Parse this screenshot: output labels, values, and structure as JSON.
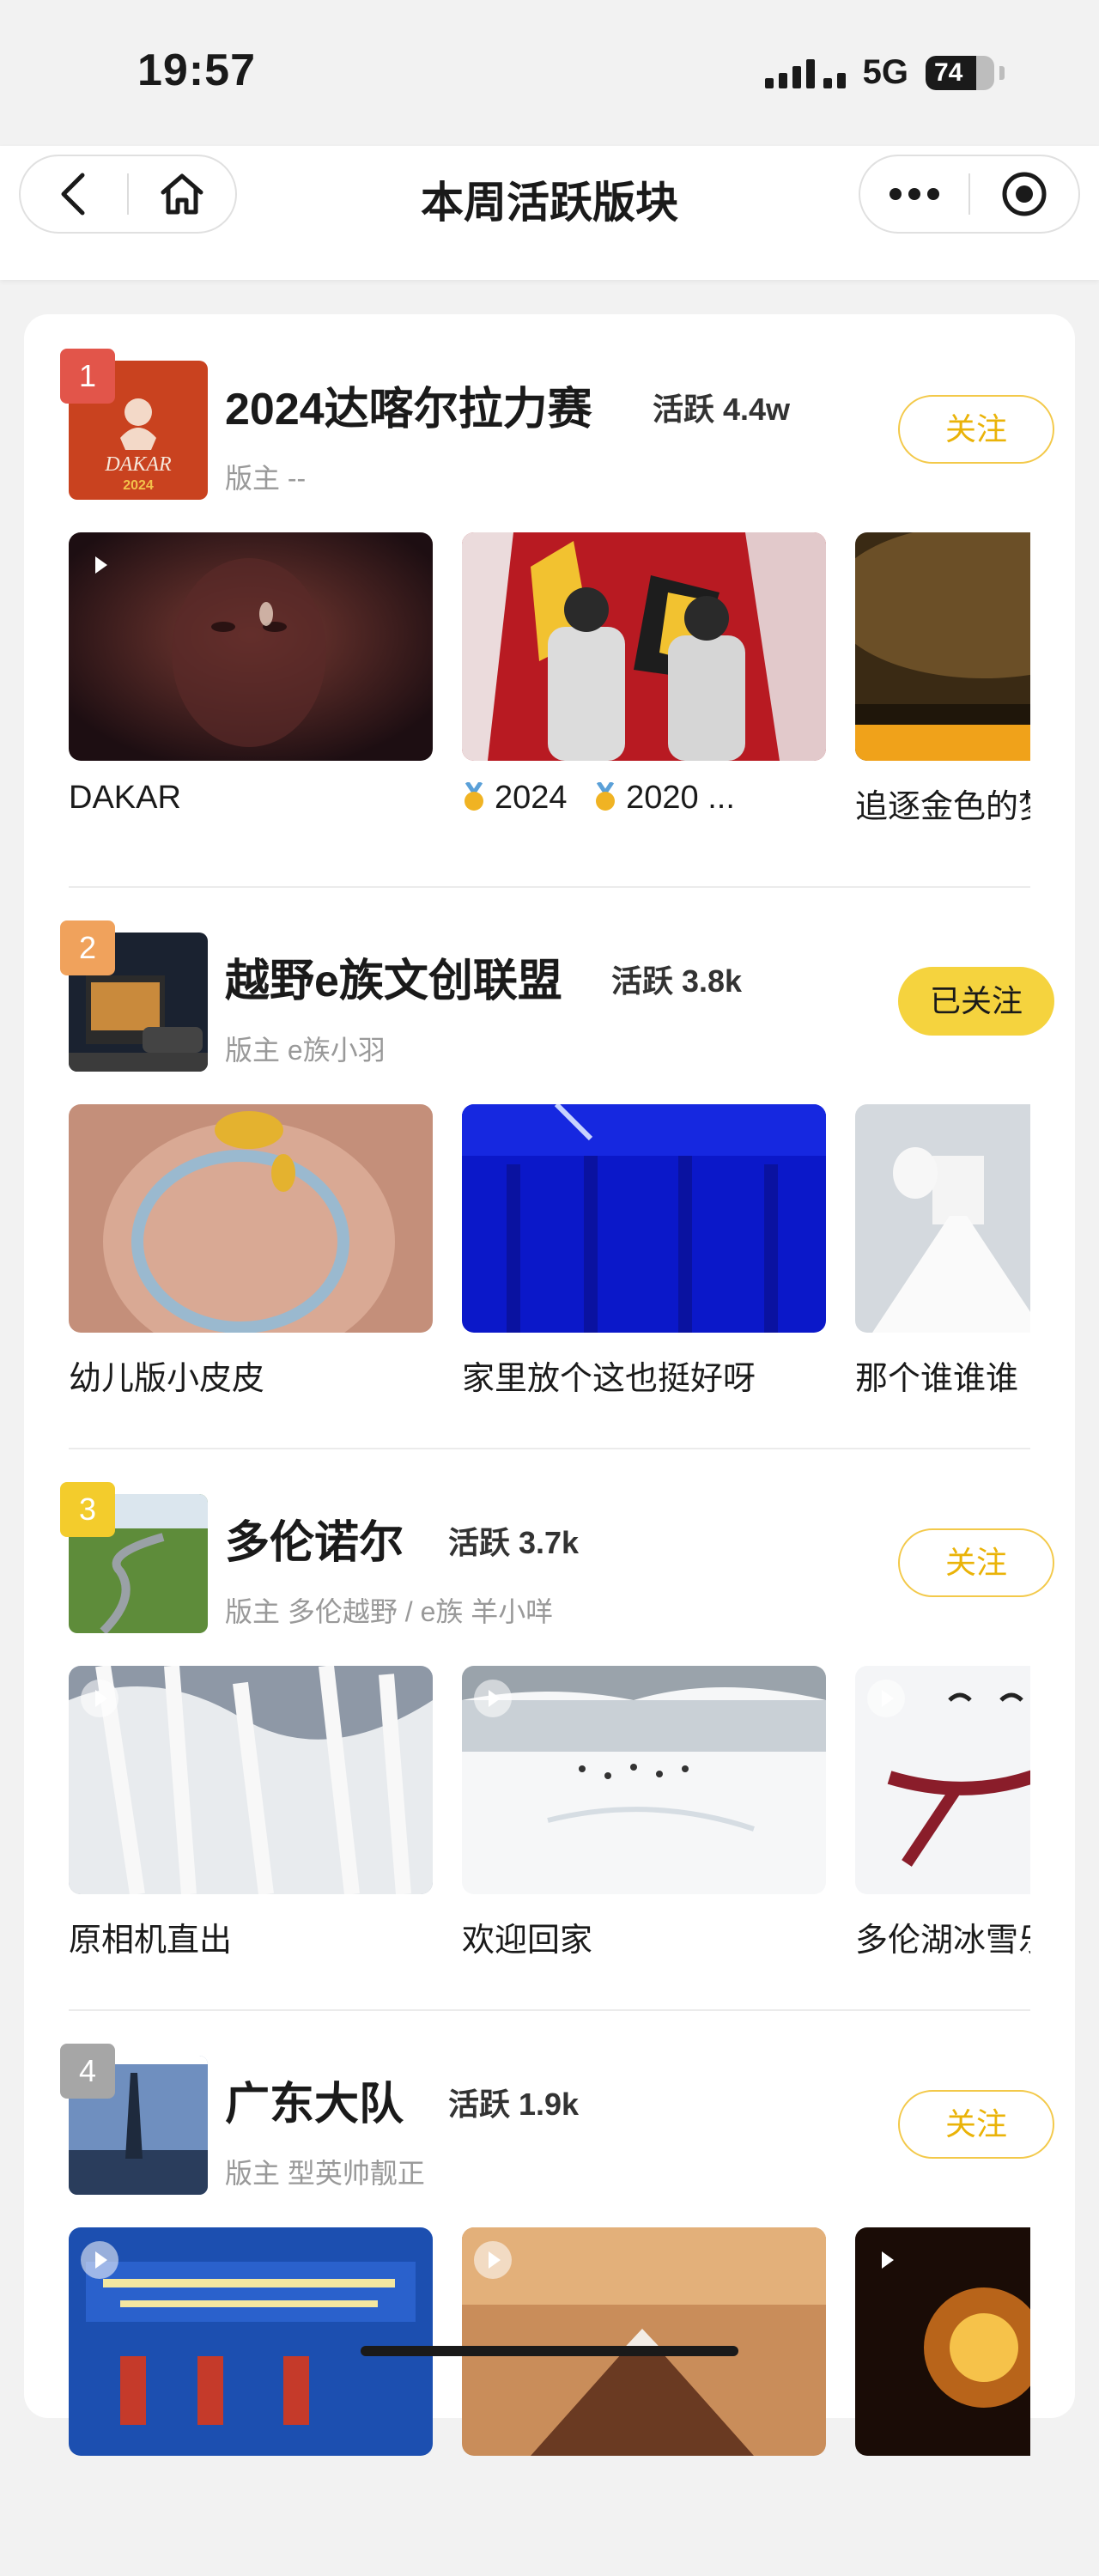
{
  "status_bar": {
    "time": "19:57",
    "network": "5G",
    "battery": "74",
    "battery_level_percent": 74
  },
  "nav": {
    "title": "本周活跃版块",
    "back_icon": "chevron-left-icon",
    "home_icon": "home-icon",
    "more_icon": "more-icon",
    "capsule_icon": "record-icon"
  },
  "colors": {
    "accent_yellow": "#f5d33e",
    "follow_text": "#eab308",
    "rank1": "#e2554a",
    "rank2": "#f0a25c",
    "rank3": "#f3cc2c",
    "rank4": "#a6a6a6"
  },
  "boards": [
    {
      "rank": "1",
      "name": "2024达喀尔拉力赛",
      "active": "活跃 4.4w",
      "moderator": "版主 --",
      "follow": "关注",
      "followed": false,
      "posts": [
        {
          "title": "DAKAR",
          "video": true
        },
        {
          "title": "🏅 2024 🏅 2020 ...",
          "parts": [
            "2024",
            "2020 ..."
          ],
          "video": false
        },
        {
          "title": "追逐金色的梦",
          "video": false
        }
      ]
    },
    {
      "rank": "2",
      "name": "越野e族文创联盟",
      "active": "活跃 3.8k",
      "moderator": "版主 e族小羽",
      "follow": "已关注",
      "followed": true,
      "posts": [
        {
          "title": "幼儿版小皮皮",
          "video": false
        },
        {
          "title": "家里放个这也挺好呀",
          "video": false
        },
        {
          "title": "那个谁谁谁",
          "video": false
        }
      ]
    },
    {
      "rank": "3",
      "name": "多伦诺尔",
      "active": "活跃 3.7k",
      "moderator": "版主 多伦越野 / e族 羊小咩",
      "follow": "关注",
      "followed": false,
      "posts": [
        {
          "title": "原相机直出",
          "video": true
        },
        {
          "title": "欢迎回家",
          "video": true
        },
        {
          "title": "多伦湖冰雪乐",
          "video": true
        }
      ]
    },
    {
      "rank": "4",
      "name": "广东大队",
      "active": "活跃 1.9k",
      "moderator": "版主 型英帅靓正",
      "follow": "关注",
      "followed": false,
      "posts": [
        {
          "title": "",
          "video": true
        },
        {
          "title": "",
          "video": true
        },
        {
          "title": "",
          "video": true
        }
      ]
    }
  ]
}
